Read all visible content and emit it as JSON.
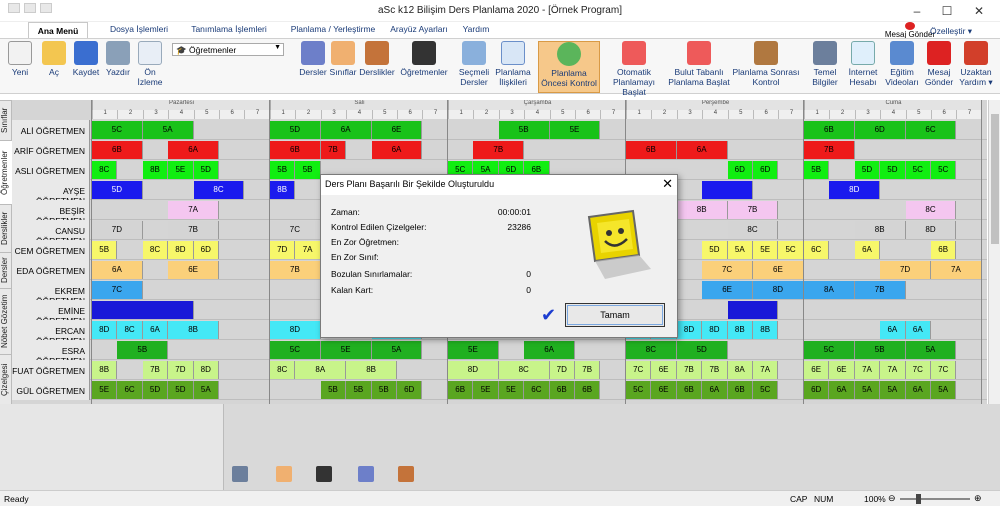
{
  "window": {
    "title": "aSc k12 Bilişim Ders Planlama 2020  - [Örnek Program]"
  },
  "tabs": [
    "Ana Menü",
    "Dosya İşlemleri",
    "Tanımlama İşlemleri",
    "Planlama / Yerleştirme",
    "Arayüz Ayarları",
    "Yardım"
  ],
  "top_right": {
    "mesaj": "Mesaj Gönder",
    "ozellestir": "Özelleştir ▾"
  },
  "ribbon": {
    "yeni": "Yeni",
    "ac": "Aç",
    "kaydet": "Kaydet",
    "yazdir": "Yazdır",
    "on_izleme_1": "Ön",
    "on_izleme_2": "İzleme",
    "dropdown": "Öğretmenler",
    "dersler": "Dersler",
    "siniflar": "Sınıflar",
    "derslikler": "Derslikler",
    "ogretmenler": "Öğretmenler",
    "secmeli_1": "Seçmeli",
    "secmeli_2": "Dersler",
    "planlama_il_1": "Planlama",
    "planlama_il_2": "İlişkileri",
    "pok_1": "Planlama",
    "pok_2": "Öncesi Kontrol",
    "otomatik_1": "Otomatik",
    "otomatik_2": "Planlamayı Başlat",
    "bulut_1": "Bulut Tabanlı",
    "bulut_2": "Planlama Başlat",
    "sonrasi_1": "Planlama Sonrası",
    "sonrasi_2": "Kontrol",
    "temel_1": "Temel",
    "temel_2": "Bilgiler",
    "internet_1": "İnternet",
    "internet_2": "Hesabı",
    "egitim_1": "Eğitim",
    "egitim_2": "Videoları",
    "mesaj_1": "Mesaj",
    "mesaj_2": "Gönder",
    "uzaktan_1": "Uzaktan",
    "uzaktan_2": "Yardım ▾"
  },
  "side_tabs": [
    "Sınıflar",
    "Öğretmenler",
    "Derslikler",
    "Dersler",
    "Nöbet Gözetim",
    "Çizelgesi"
  ],
  "days": [
    "Pazartesi",
    "Salı",
    "Çarşamba",
    "Perşembe",
    "Cuma"
  ],
  "periods": [
    "1",
    "2",
    "3",
    "4",
    "5",
    "6",
    "7"
  ],
  "teachers": [
    {
      "name": "ALİ ÖĞRETMEN",
      "cells": [
        [
          0,
          0,
          2,
          "5C",
          "#19c219"
        ],
        [
          0,
          2,
          2,
          "5A",
          "#19c219"
        ],
        [
          1,
          0,
          2,
          "5D",
          "#19c219"
        ],
        [
          1,
          2,
          2,
          "6A",
          "#19c219"
        ],
        [
          1,
          4,
          2,
          "6E",
          "#19c219"
        ],
        [
          2,
          2,
          2,
          "5B",
          "#19c219"
        ],
        [
          2,
          4,
          2,
          "5E",
          "#19c219"
        ],
        [
          4,
          0,
          2,
          "6B",
          "#19c219"
        ],
        [
          4,
          2,
          2,
          "6D",
          "#19c219"
        ],
        [
          4,
          4,
          2,
          "6C",
          "#19c219"
        ]
      ]
    },
    {
      "name": "ARİF ÖĞRETMEN",
      "cells": [
        [
          0,
          0,
          2,
          "6B",
          "#ee1a1a"
        ],
        [
          0,
          3,
          2,
          "6A",
          "#ee1a1a"
        ],
        [
          1,
          0,
          2,
          "6B",
          "#ee1a1a"
        ],
        [
          1,
          2,
          1,
          "7B",
          "#ee1a1a"
        ],
        [
          1,
          4,
          2,
          "6A",
          "#ee1a1a"
        ],
        [
          2,
          1,
          2,
          "7B",
          "#ee1a1a"
        ],
        [
          3,
          0,
          2,
          "6B",
          "#ee1a1a"
        ],
        [
          3,
          2,
          2,
          "6A",
          "#ee1a1a"
        ],
        [
          4,
          0,
          2,
          "7B",
          "#ee1a1a"
        ]
      ]
    },
    {
      "name": "ASLI ÖĞRETMEN",
      "cells": [
        [
          0,
          0,
          1,
          "8C",
          "#11ee11"
        ],
        [
          0,
          2,
          1,
          "8B",
          "#11ee11"
        ],
        [
          0,
          3,
          1,
          "5E",
          "#11ee11"
        ],
        [
          0,
          4,
          1,
          "5D",
          "#11ee11"
        ],
        [
          1,
          0,
          1,
          "5B",
          "#11ee11"
        ],
        [
          1,
          1,
          1,
          "5B",
          "#11ee11"
        ],
        [
          2,
          0,
          1,
          "5C",
          "#11ee11"
        ],
        [
          2,
          1,
          1,
          "5A",
          "#11ee11"
        ],
        [
          2,
          2,
          1,
          "6D",
          "#11ee11"
        ],
        [
          2,
          3,
          1,
          "6B",
          "#11ee11"
        ],
        [
          3,
          4,
          1,
          "6D",
          "#11ee11"
        ],
        [
          3,
          5,
          1,
          "6D",
          "#11ee11"
        ],
        [
          4,
          0,
          1,
          "5B",
          "#11ee11"
        ],
        [
          4,
          2,
          1,
          "5D",
          "#11ee11"
        ],
        [
          4,
          3,
          1,
          "5D",
          "#11ee11"
        ],
        [
          4,
          4,
          1,
          "5C",
          "#11ee11"
        ],
        [
          4,
          5,
          1,
          "5C",
          "#11ee11"
        ]
      ]
    },
    {
      "name": "AYŞE ÖĞRETMEN",
      "cells": [
        [
          0,
          0,
          2,
          "5D",
          "#1a1aee"
        ],
        [
          0,
          4,
          2,
          "8C",
          "#1a1aee"
        ],
        [
          1,
          0,
          1,
          "8B",
          "#1a1aee"
        ],
        [
          3,
          3,
          2,
          "",
          "#1a1aee"
        ],
        [
          4,
          1,
          2,
          "8D",
          "#1a1aee"
        ]
      ]
    },
    {
      "name": "BEŞİR ÖĞRETMEN",
      "cells": [
        [
          0,
          3,
          2,
          "7A",
          "#f4c6f0"
        ],
        [
          3,
          2,
          2,
          "8B",
          "#f4c6f0"
        ],
        [
          3,
          4,
          2,
          "7B",
          "#f4c6f0"
        ],
        [
          4,
          4,
          2,
          "8C",
          "#f4c6f0"
        ]
      ]
    },
    {
      "name": "CANSU ÖĞRETMEN",
      "cells": [
        [
          0,
          0,
          2,
          "7D",
          "#d4d4d4"
        ],
        [
          0,
          3,
          2,
          "7B",
          "#d4d4d4"
        ],
        [
          1,
          0,
          2,
          "7C",
          "#d4d4d4"
        ],
        [
          3,
          4,
          2,
          "8C",
          "#d4d4d4"
        ],
        [
          4,
          2,
          2,
          "8B",
          "#d4d4d4"
        ],
        [
          4,
          4,
          2,
          "8D",
          "#d4d4d4"
        ]
      ]
    },
    {
      "name": "CEM ÖĞRETMEN",
      "cells": [
        [
          0,
          0,
          1,
          "5B",
          "#f7f76a"
        ],
        [
          0,
          2,
          1,
          "8C",
          "#f7f76a"
        ],
        [
          0,
          3,
          1,
          "8D",
          "#f7f76a"
        ],
        [
          0,
          4,
          1,
          "6D",
          "#f7f76a"
        ],
        [
          1,
          0,
          1,
          "7D",
          "#f7f76a"
        ],
        [
          1,
          1,
          1,
          "7A",
          "#f7f76a"
        ],
        [
          3,
          3,
          1,
          "5D",
          "#f7f76a"
        ],
        [
          3,
          4,
          1,
          "5A",
          "#f7f76a"
        ],
        [
          3,
          5,
          1,
          "5E",
          "#f7f76a"
        ],
        [
          3,
          6,
          1,
          "5C",
          "#f7f76a"
        ],
        [
          4,
          0,
          1,
          "6C",
          "#f7f76a"
        ],
        [
          4,
          2,
          1,
          "6A",
          "#f7f76a"
        ],
        [
          4,
          5,
          1,
          "6B",
          "#f7f76a"
        ]
      ]
    },
    {
      "name": "EDA ÖĞRETMEN",
      "cells": [
        [
          0,
          0,
          2,
          "6A",
          "#fbd07a"
        ],
        [
          0,
          3,
          2,
          "6E",
          "#fbd07a"
        ],
        [
          1,
          0,
          2,
          "7B",
          "#fbd07a"
        ],
        [
          3,
          3,
          2,
          "7C",
          "#fbd07a"
        ],
        [
          3,
          5,
          2,
          "6E",
          "#fbd07a"
        ],
        [
          4,
          3,
          2,
          "7D",
          "#fbd07a"
        ],
        [
          4,
          5,
          2,
          "7A",
          "#fbd07a"
        ]
      ]
    },
    {
      "name": "EKREM ÖĞRETMEN",
      "cells": [
        [
          0,
          0,
          2,
          "7C",
          "#3aa6ee"
        ],
        [
          3,
          3,
          2,
          "6E",
          "#3aa6ee"
        ],
        [
          3,
          5,
          2,
          "8D",
          "#3aa6ee"
        ],
        [
          4,
          0,
          2,
          "8A",
          "#3aa6ee"
        ],
        [
          4,
          2,
          2,
          "7B",
          "#3aa6ee"
        ]
      ]
    },
    {
      "name": "EMİNE ÖĞRETMEN",
      "cells": [
        [
          0,
          0,
          4,
          "",
          "#1818d8"
        ],
        [
          3,
          4,
          2,
          "",
          "#1818d8"
        ]
      ]
    },
    {
      "name": "ERCAN ÖĞRETMEN",
      "cells": [
        [
          0,
          0,
          1,
          "8D",
          "#44e8f6"
        ],
        [
          0,
          1,
          1,
          "8C",
          "#44e8f6"
        ],
        [
          0,
          2,
          1,
          "6A",
          "#44e8f6"
        ],
        [
          0,
          3,
          2,
          "8B",
          "#44e8f6"
        ],
        [
          1,
          0,
          2,
          "8D",
          "#44e8f6"
        ],
        [
          1,
          4,
          2,
          "8C",
          "#44e8f6"
        ],
        [
          3,
          0,
          1,
          "6A",
          "#44e8f6"
        ],
        [
          3,
          1,
          1,
          "8A",
          "#44e8f6"
        ],
        [
          3,
          2,
          1,
          "8D",
          "#44e8f6"
        ],
        [
          3,
          3,
          1,
          "8D",
          "#44e8f6"
        ],
        [
          3,
          4,
          1,
          "8B",
          "#44e8f6"
        ],
        [
          3,
          5,
          1,
          "8B",
          "#44e8f6"
        ],
        [
          4,
          3,
          1,
          "6A",
          "#44e8f6"
        ],
        [
          4,
          4,
          1,
          "6A",
          "#44e8f6"
        ]
      ]
    },
    {
      "name": "ESRA ÖĞRETMEN",
      "cells": [
        [
          0,
          1,
          2,
          "5B",
          "#20b020"
        ],
        [
          1,
          0,
          2,
          "5C",
          "#20b020"
        ],
        [
          1,
          2,
          2,
          "5E",
          "#20b020"
        ],
        [
          1,
          4,
          2,
          "5A",
          "#20b020"
        ],
        [
          2,
          0,
          2,
          "5E",
          "#20b020"
        ],
        [
          2,
          3,
          2,
          "6A",
          "#20b020"
        ],
        [
          3,
          0,
          2,
          "8C",
          "#20b020"
        ],
        [
          3,
          2,
          2,
          "5D",
          "#20b020"
        ],
        [
          4,
          0,
          2,
          "5C",
          "#20b020"
        ],
        [
          4,
          2,
          2,
          "5B",
          "#20b020"
        ],
        [
          4,
          4,
          2,
          "5A",
          "#20b020"
        ]
      ]
    },
    {
      "name": "FUAT ÖĞRETMEN",
      "cells": [
        [
          0,
          0,
          1,
          "8B",
          "#c8f48a"
        ],
        [
          0,
          2,
          1,
          "7B",
          "#c8f48a"
        ],
        [
          0,
          3,
          1,
          "7D",
          "#c8f48a"
        ],
        [
          0,
          4,
          1,
          "8D",
          "#c8f48a"
        ],
        [
          1,
          0,
          1,
          "8C",
          "#c8f48a"
        ],
        [
          1,
          1,
          2,
          "8A",
          "#c8f48a"
        ],
        [
          1,
          3,
          2,
          "8B",
          "#c8f48a"
        ],
        [
          2,
          0,
          2,
          "8D",
          "#c8f48a"
        ],
        [
          2,
          2,
          2,
          "8C",
          "#c8f48a"
        ],
        [
          2,
          4,
          1,
          "7D",
          "#c8f48a"
        ],
        [
          2,
          5,
          1,
          "7B",
          "#c8f48a"
        ],
        [
          3,
          0,
          1,
          "7C",
          "#c8f48a"
        ],
        [
          3,
          1,
          1,
          "6E",
          "#c8f48a"
        ],
        [
          3,
          2,
          1,
          "7B",
          "#c8f48a"
        ],
        [
          3,
          3,
          1,
          "7B",
          "#c8f48a"
        ],
        [
          3,
          4,
          1,
          "8A",
          "#c8f48a"
        ],
        [
          3,
          5,
          1,
          "7A",
          "#c8f48a"
        ],
        [
          4,
          0,
          1,
          "6E",
          "#c8f48a"
        ],
        [
          4,
          1,
          1,
          "6E",
          "#c8f48a"
        ],
        [
          4,
          2,
          1,
          "7A",
          "#c8f48a"
        ],
        [
          4,
          3,
          1,
          "7A",
          "#c8f48a"
        ],
        [
          4,
          4,
          1,
          "7C",
          "#c8f48a"
        ],
        [
          4,
          5,
          1,
          "7C",
          "#c8f48a"
        ]
      ]
    },
    {
      "name": "GÜL ÖĞRETMEN",
      "cells": [
        [
          0,
          0,
          1,
          "5E",
          "#5aa620"
        ],
        [
          0,
          1,
          1,
          "6C",
          "#5aa620"
        ],
        [
          0,
          2,
          1,
          "5D",
          "#5aa620"
        ],
        [
          0,
          3,
          1,
          "5D",
          "#5aa620"
        ],
        [
          0,
          4,
          1,
          "5A",
          "#5aa620"
        ],
        [
          1,
          2,
          1,
          "5B",
          "#5aa620"
        ],
        [
          1,
          3,
          1,
          "5B",
          "#5aa620"
        ],
        [
          1,
          4,
          1,
          "5B",
          "#5aa620"
        ],
        [
          1,
          5,
          1,
          "6D",
          "#5aa620"
        ],
        [
          2,
          0,
          1,
          "6B",
          "#5aa620"
        ],
        [
          2,
          1,
          1,
          "5E",
          "#5aa620"
        ],
        [
          2,
          2,
          1,
          "5E",
          "#5aa620"
        ],
        [
          2,
          3,
          1,
          "6C",
          "#5aa620"
        ],
        [
          2,
          4,
          1,
          "6B",
          "#5aa620"
        ],
        [
          2,
          5,
          1,
          "6B",
          "#5aa620"
        ],
        [
          3,
          0,
          1,
          "5C",
          "#5aa620"
        ],
        [
          3,
          1,
          1,
          "6E",
          "#5aa620"
        ],
        [
          3,
          2,
          1,
          "6B",
          "#5aa620"
        ],
        [
          3,
          3,
          1,
          "6A",
          "#5aa620"
        ],
        [
          3,
          4,
          1,
          "6B",
          "#5aa620"
        ],
        [
          3,
          5,
          1,
          "5C",
          "#5aa620"
        ],
        [
          4,
          0,
          1,
          "6D",
          "#5aa620"
        ],
        [
          4,
          1,
          1,
          "6A",
          "#5aa620"
        ],
        [
          4,
          2,
          1,
          "5A",
          "#5aa620"
        ],
        [
          4,
          3,
          1,
          "5A",
          "#5aa620"
        ],
        [
          4,
          4,
          1,
          "6A",
          "#5aa620"
        ],
        [
          4,
          5,
          1,
          "5A",
          "#5aa620"
        ]
      ]
    }
  ],
  "dialog": {
    "title": "Ders Planı Başarılı Bir Şekilde Oluşturuldu",
    "zaman_label": "Zaman:",
    "zaman_val": "00:00:01",
    "kontrol_label": "Kontrol Edilen Çizelgeler:",
    "kontrol_val": "23286",
    "enzor_ogr": "En Zor Öğretmen:",
    "enzor_sinif": "En Zor Sınıf:",
    "bozulan_label": "Bozulan Sınırlamalar:",
    "bozulan_val": "0",
    "kalan_label": "Kalan Kart:",
    "kalan_val": "0",
    "ok": "Tamam"
  },
  "status": {
    "ready": "Ready",
    "cap": "CAP",
    "num": "NUM",
    "zoom": "100%"
  }
}
